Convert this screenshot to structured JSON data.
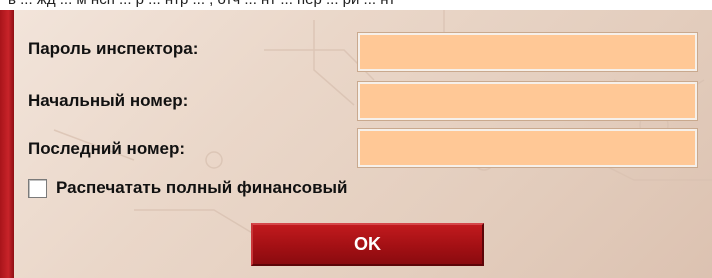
{
  "window": {
    "title_fragment": "в ... жд ... м нсп ... р ... нтр ... , отч ... нт ... пер ... ри ... нт"
  },
  "form": {
    "fields": [
      {
        "label": "Пароль  инспектора:",
        "value": ""
      },
      {
        "label": "Начальный номер:",
        "value": ""
      },
      {
        "label": "Последний номер:",
        "value": ""
      }
    ],
    "checkbox": {
      "label": "Распечатать полный финансовый",
      "checked": false
    },
    "ok_label": "OK"
  },
  "colors": {
    "field_bg": "#ffc896",
    "panel_bg": "#ead7c9",
    "button_bg": "#a31014",
    "edge_red": "#c8242a"
  }
}
